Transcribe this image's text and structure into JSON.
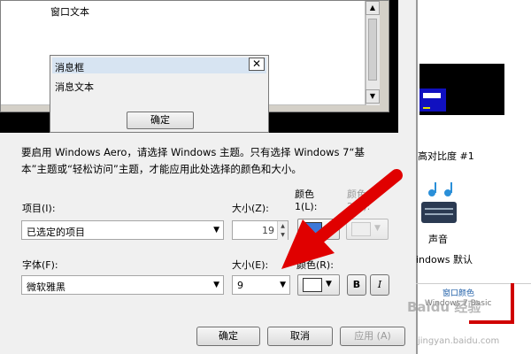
{
  "preview": {
    "window_text": "窗口文本",
    "msgbox_title": "消息框",
    "msgbox_text": "消息文本",
    "msgbox_ok": "确定",
    "close_glyph": "✕",
    "up_glyph": "▲",
    "down_glyph": "▼"
  },
  "info_line1": "要启用 Windows Aero，请选择 Windows 主题。只有选择 Windows 7“基",
  "info_line2": "本”主题或“轻松访问”主题，才能应用此处选择的颜色和大小。",
  "item": {
    "label": "项目(I):",
    "value": "已选定的项目",
    "size_label": "大小(Z):",
    "size_value": "19",
    "color1_label_a": "颜色",
    "color1_label_b": "1(L):",
    "color2_label_a": "颜色",
    "color2_label_b": "2(2):",
    "color1": "#3c78d8"
  },
  "font": {
    "label": "字体(F):",
    "value": "微软雅黑",
    "size_label": "大小(E):",
    "size_value": "9",
    "color_label": "颜色(R):",
    "bold": "B",
    "italic": "I",
    "color": "#ffffff"
  },
  "buttons": {
    "ok": "确定",
    "cancel": "取消",
    "apply": "应用 (A)"
  },
  "right_panel": {
    "theme1": "高对比度 #1",
    "theme2_name": "声音",
    "theme2_sub": "indows 默认",
    "bottom_label": "窗口颜色",
    "bottom_sub": "Windows 7 Basic",
    "watermark1": "Baidu 经验",
    "watermark2": "jingyan.baidu.com"
  },
  "arrow_color": "#e00000"
}
